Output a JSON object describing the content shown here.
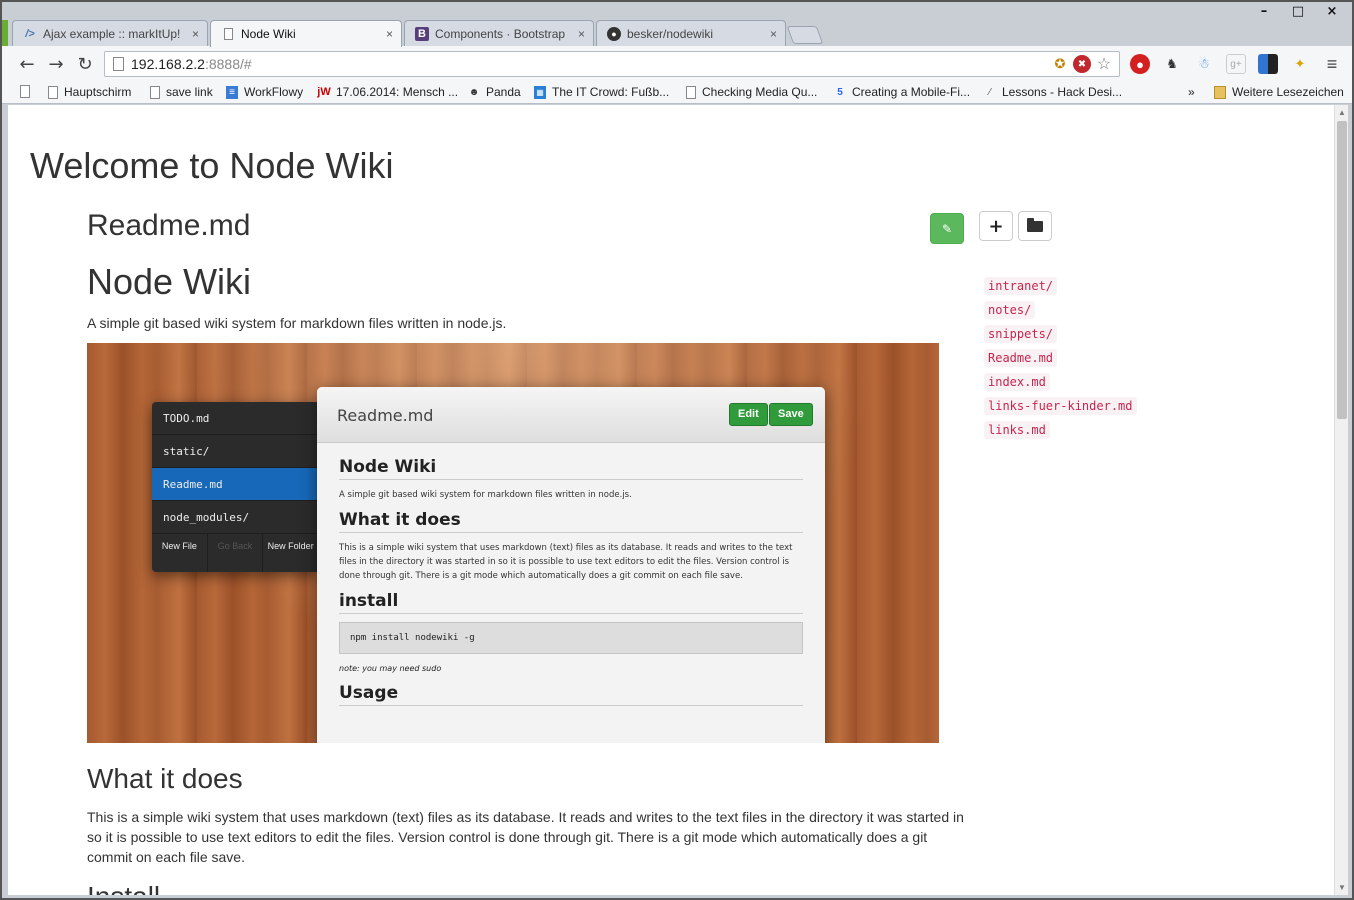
{
  "window": {
    "minimize": "–",
    "maximize": "□",
    "close": "×"
  },
  "tabs": [
    {
      "label": "Ajax example :: markItUp!",
      "icon": "markitup-icon",
      "close": "×"
    },
    {
      "label": "Node Wiki",
      "icon": "page-icon",
      "close": "×"
    },
    {
      "label": "Components · Bootstrap",
      "icon": "bootstrap-icon",
      "close": "×"
    },
    {
      "label": "besker/nodewiki",
      "icon": "github-icon",
      "close": "×"
    }
  ],
  "toolbar": {
    "back": "←",
    "forward": "→",
    "reload": "↻",
    "url_host": "192.168.2.2",
    "url_rest": ":8888/#",
    "menu": "≡"
  },
  "bookmarks": [
    {
      "label": "Hauptschirm"
    },
    {
      "label": "save link"
    },
    {
      "label": "WorkFlowy"
    },
    {
      "label": "17.06.2014: Mensch ..."
    },
    {
      "label": "Panda"
    },
    {
      "label": "The IT Crowd: Fußb..."
    },
    {
      "label": "Checking Media Qu..."
    },
    {
      "label": "Creating a Mobile-Fi..."
    },
    {
      "label": "Lessons - Hack Desi..."
    }
  ],
  "bookmarks_more": "»",
  "bookmarks_other": "Weitere Lesezeichen",
  "page": {
    "title": "Welcome to Node Wiki",
    "file_title": "Readme.md",
    "h1": "Node Wiki",
    "intro": "A simple git based wiki system for markdown files written in node.js.",
    "h2_what": "What it does",
    "what_text": "This is a simple wiki system that uses markdown (text) files as its database. It reads and writes to the text files in the directory it was started in so it is possible to use text editors to edit the files. Version control is done through git. There is a git mode which automatically does a git commit on each file save.",
    "h2_install": "Install",
    "add_button": "+"
  },
  "files": [
    "intranet/",
    "notes/",
    "snippets/",
    "Readme.md",
    "index.md",
    "links-fuer-kinder.md",
    "links.md"
  ],
  "screenshot": {
    "sidebar": [
      "TODO.md",
      "static/",
      "Readme.md",
      "node_modules/"
    ],
    "btn_new_file": "New File",
    "btn_go_back": "Go Back",
    "btn_new_folder": "New Folder",
    "title": "Readme.md",
    "edit": "Edit",
    "save": "Save",
    "h_node_wiki": "Node Wiki",
    "p_intro": "A simple git based wiki system for markdown files written in node.js.",
    "h_what": "What it does",
    "p_what": "This is a simple wiki system that uses markdown (text) files as its database. It reads and writes to the text files in the directory it was started in so it is possible to use text editors to edit the files. Version control is done through git. There is a git mode which automatically does a git commit on each file save.",
    "h_install": "install",
    "code": "npm install nodewiki -g",
    "note": "note: you may need sudo",
    "h_usage": "Usage"
  },
  "colors": {
    "accent_green": "#5cb85c",
    "file_link": "#c7254e",
    "selected_blue": "#1768b8"
  }
}
